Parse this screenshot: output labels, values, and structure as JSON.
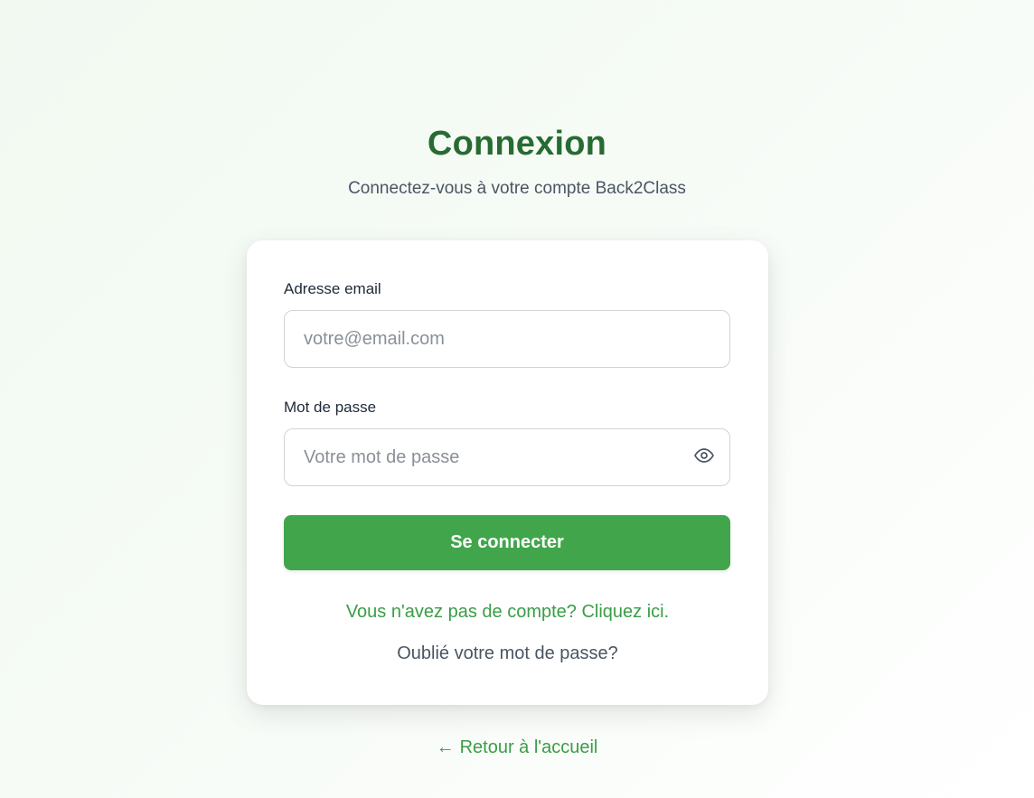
{
  "header": {
    "title": "Connexion",
    "subtitle": "Connectez-vous à votre compte Back2Class"
  },
  "form": {
    "email_label": "Adresse email",
    "email_placeholder": "votre@email.com",
    "email_value": "",
    "password_label": "Mot de passe",
    "password_placeholder": "Votre mot de passe",
    "password_value": "",
    "password_toggle_icon": "eye-icon",
    "submit_label": "Se connecter",
    "signup_link": "Vous n'avez pas de compte? Cliquez ici.",
    "forgot_link": "Oublié votre mot de passe?"
  },
  "footer": {
    "back_arrow": "←",
    "back_label": "Retour à l'accueil"
  },
  "colors": {
    "primary_green": "#41a64b",
    "title_green": "#276b32",
    "link_green": "#3a9d46"
  }
}
